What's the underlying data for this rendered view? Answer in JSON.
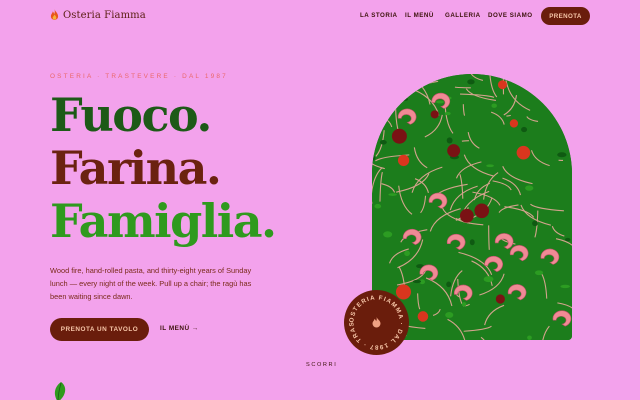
{
  "brand": {
    "name": "Osteria Fiamma",
    "icon": "flame-icon"
  },
  "nav": {
    "links": [
      "LA STORIA",
      "IL MENÙ",
      "GALLERIA",
      "DOVE SIAMO"
    ],
    "cta": "PRENOTA"
  },
  "hero": {
    "eyebrow": "OSTERIA · TRASTEVERE · DAL 1987",
    "headline": [
      "Fuoco.",
      "Farina.",
      "Famiglia."
    ],
    "lede": "Wood fire, hand-rolled pasta, and thirty-eight years of Sunday lunch — every night of the week. Pull up a chair; the ragù has been waiting since dawn.",
    "primary_cta": "PRENOTA UN TAVOLO",
    "secondary_cta": "IL MENÙ →",
    "scroll_hint": "SCORRI"
  },
  "badge": {
    "text": "OSTERIA FIAMMA · DAL 1987 · TRASTEVERE · "
  },
  "colors": {
    "background": "#f3a2ec",
    "brand_brown": "#6a1d0c",
    "green_dark": "#1d5a17",
    "green_bright": "#2f9a1e",
    "accent_coral": "#e9686a"
  }
}
